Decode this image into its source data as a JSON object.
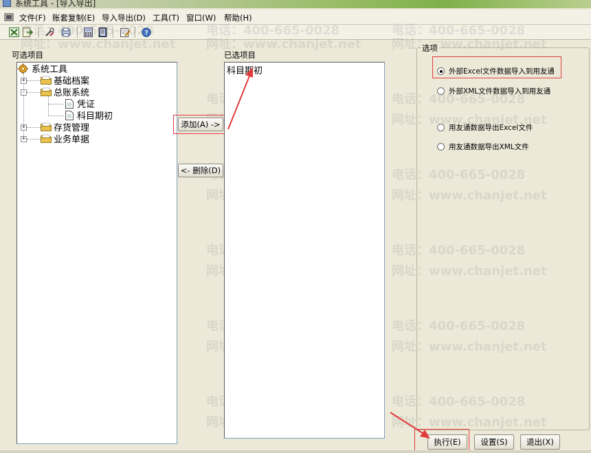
{
  "window": {
    "title": "系统工具 - [导入导出]"
  },
  "menu": [
    "文件(F)",
    "账套复制(E)",
    "导入导出(D)",
    "工具(T)",
    "窗口(W)",
    "帮助(H)"
  ],
  "toolbar": {
    "icons": [
      "excel-export-icon",
      "export-icon",
      "tools-icon",
      "print-preview-icon",
      "calculator-icon",
      "book-icon",
      "edit-icon",
      "help-icon"
    ]
  },
  "available": {
    "label": "可选项目",
    "tree": {
      "root": "系统工具",
      "items": [
        {
          "label": "基础档案",
          "expander": "+"
        },
        {
          "label": "总账系统",
          "expander": "-",
          "children": [
            "凭证",
            "科目期初"
          ]
        },
        {
          "label": "存货管理",
          "expander": "+"
        },
        {
          "label": "业务单据",
          "expander": "+"
        }
      ]
    }
  },
  "selected": {
    "label": "已选项目",
    "items": [
      "科目期初"
    ]
  },
  "buttons": {
    "add": "添加(A) ->",
    "remove": "<- 删除(D)",
    "execute": "执行(E)",
    "settings": "设置(S)",
    "exit": "退出(X)"
  },
  "options": {
    "title": "选项",
    "radios": [
      {
        "label": "外部Excel文件数据导入到用友通",
        "checked": true
      },
      {
        "label": "外部XML文件数据导入到用友通",
        "checked": false
      },
      {
        "label": "用友通数据导出Excel文件",
        "checked": false
      },
      {
        "label": "用友通数据导出XML文件",
        "checked": false
      }
    ]
  },
  "watermark": {
    "phone": "电话：400-665-0028",
    "site": "网址：www.chanjet.net"
  },
  "colors": {
    "highlight": "#e23b3b",
    "accent": "#316ac5"
  }
}
